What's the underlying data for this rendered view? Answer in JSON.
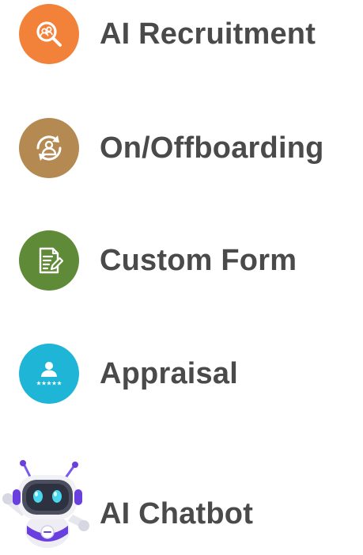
{
  "features": [
    {
      "label": "AI Recruitment",
      "icon": "recruitment-search-icon",
      "color": "#f2823a"
    },
    {
      "label": "On/Offboarding",
      "icon": "onboarding-cycle-icon",
      "color": "#b48a52"
    },
    {
      "label": "Custom Form",
      "icon": "form-edit-icon",
      "color": "#5f8a37"
    },
    {
      "label": "Appraisal",
      "icon": "appraisal-rating-icon",
      "color": "#1fb5d6"
    },
    {
      "label": "AI Chatbot",
      "icon": "robot-mascot-icon",
      "color": "#6a3fe0"
    }
  ]
}
